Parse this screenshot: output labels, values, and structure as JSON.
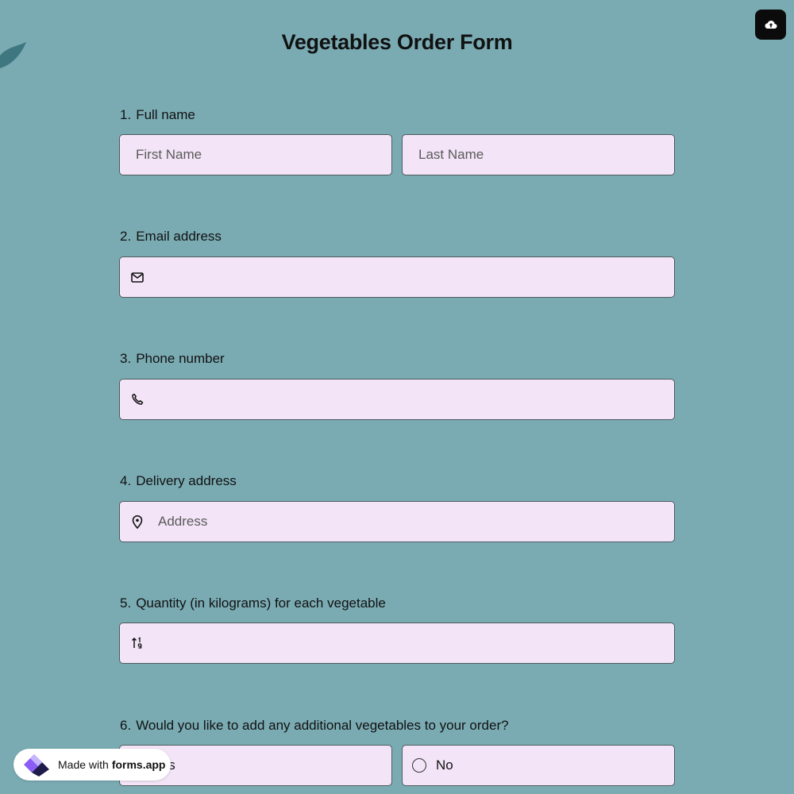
{
  "form": {
    "title": "Vegetables Order Form"
  },
  "questions": [
    {
      "number": "1.",
      "label": "Full name",
      "first_placeholder": "First Name",
      "last_placeholder": "Last Name"
    },
    {
      "number": "2.",
      "label": "Email address",
      "placeholder": "",
      "icon": "envelope-icon"
    },
    {
      "number": "3.",
      "label": "Phone number",
      "placeholder": "",
      "icon": "phone-icon"
    },
    {
      "number": "4.",
      "label": "Delivery address",
      "placeholder": "Address",
      "icon": "map-pin-icon"
    },
    {
      "number": "5.",
      "label": "Quantity (in kilograms) for each vegetable",
      "placeholder": "",
      "icon": "number-sort-icon"
    },
    {
      "number": "6.",
      "label": "Would you like to add any additional vegetables to your order?",
      "options": [
        "Yes",
        "No"
      ]
    }
  ],
  "badge": {
    "prefix": "Made with",
    "brand": "forms.app"
  },
  "colors": {
    "background": "#7aabb3",
    "field": "#f3e5f7",
    "field_border": "#4c5a5e",
    "upload_button": "#0b0b0b",
    "logo_purple": "#8b5cf6"
  }
}
